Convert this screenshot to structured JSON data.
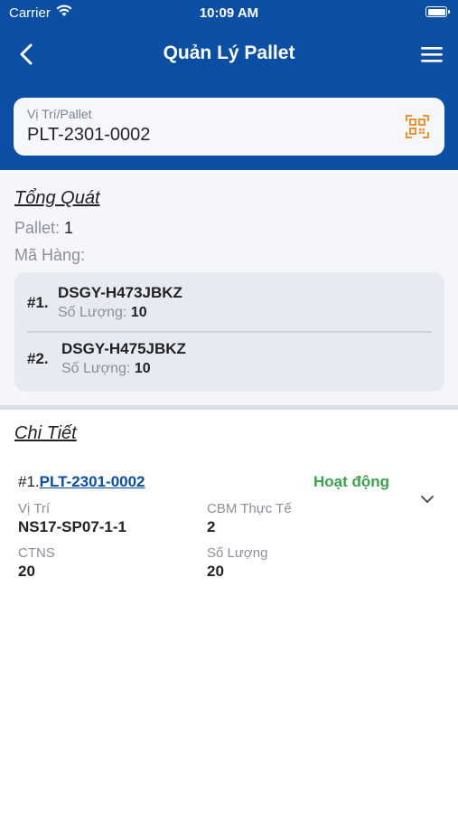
{
  "status_bar": {
    "carrier": "Carrier",
    "time": "10:09 AM"
  },
  "nav": {
    "title": "Quản Lý Pallet",
    "back_icon": "chevron-left-icon",
    "menu_icon": "hamburger-menu-icon"
  },
  "search": {
    "label": "Vị Trí/Pallet",
    "value": "PLT-2301-0002",
    "scan_icon": "qr-scan-icon"
  },
  "overview": {
    "title": "Tổng Quát",
    "pallet_label": "Pallet:",
    "pallet_value": "1",
    "product_label": "Mã Hàng:",
    "items": [
      {
        "index": "#1.",
        "code": "DSGY-H473JBKZ",
        "qty_label": "Số Lượng:",
        "qty": "10"
      },
      {
        "index": "#2.",
        "code": "DSGY-H475JBKZ",
        "qty_label": "Số Lượng:",
        "qty": "10"
      }
    ]
  },
  "detail": {
    "title": "Chi Tiết",
    "card": {
      "index": "#1.",
      "pallet": "PLT-2301-0002",
      "status": "Hoạt động",
      "fields": {
        "location_label": "Vị Trí",
        "location_value": "NS17-SP07-1-1",
        "cbm_label": "CBM Thực Tế",
        "cbm_value": "2",
        "ctns_label": "CTNS",
        "ctns_value": "20",
        "qty_label": "Số Lượng",
        "qty_value": "20"
      }
    }
  },
  "colors": {
    "brand": "#0a4fa3",
    "accent": "#f0932b",
    "active": "#3aa34a"
  }
}
